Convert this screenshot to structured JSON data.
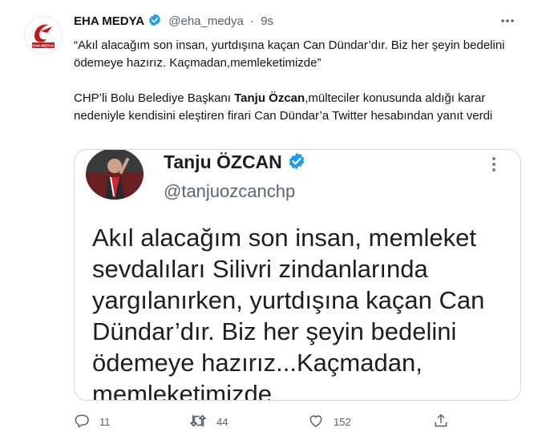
{
  "tweet": {
    "author_name": "EHA MEDYA",
    "handle": "@eha_medya",
    "separator": "·",
    "time": "9s",
    "logo_text": "EHA MEDYA",
    "quote": "“Akıl alacağım son insan, yurtdışına kaçan Can Dündar’dır. Biz her şeyin bedelini ödemeye hazırız. Kaçmadan,memleketimizde”",
    "body_before": "CHP’li Bolu Belediye Başkanı ",
    "body_bold": "Tanju Özcan",
    "body_after": ",mülteciler konusunda aldığı karar nedeniyle kendisini eleştiren firari Can Dündar’a Twitter hesabından yanıt verdi"
  },
  "media": {
    "name": "Tanju ÖZCAN",
    "handle": "@tanjuozcanchp",
    "text": "Akıl alacağım son insan, memleket sevdalıları Silivri zindanlarında yargılanırken, yurtdışına kaçan Can Dündar’dır. Biz her şeyin bedelini ödemeye hazırız...Kaçmadan, memleketimizde"
  },
  "actions": {
    "replies": "11",
    "retweets": "44",
    "likes": "152"
  },
  "colors": {
    "verified": "#1d9bf0",
    "logo_red": "#c4161c",
    "secondary_text": "#536471"
  },
  "icons": [
    "verified-badge-icon",
    "more-options-icon",
    "reply-icon",
    "retweet-icon",
    "like-icon",
    "share-icon"
  ]
}
